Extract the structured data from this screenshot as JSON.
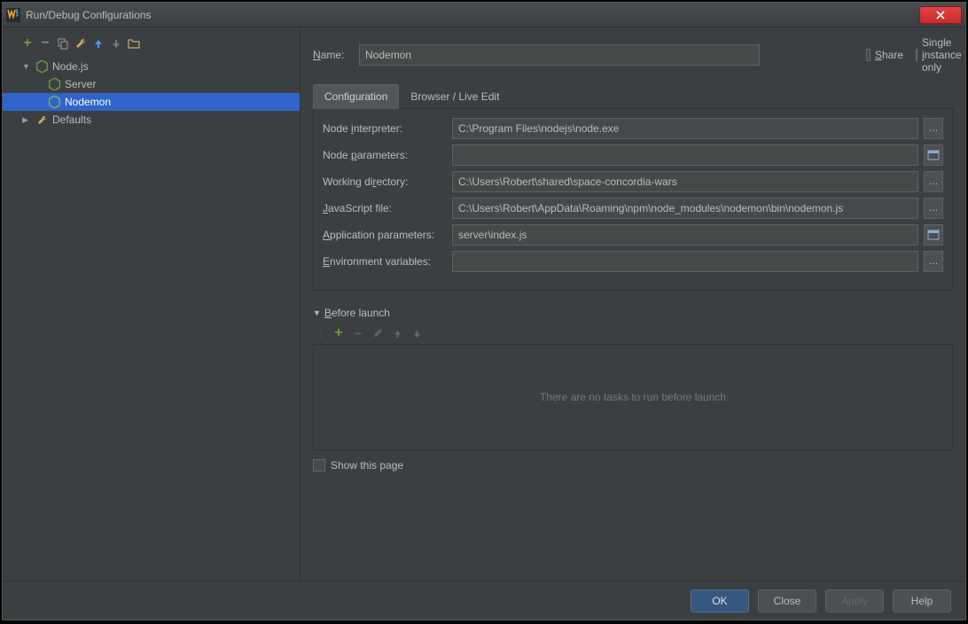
{
  "window": {
    "title": "Run/Debug Configurations"
  },
  "tree": {
    "nodejs": {
      "label": "Node.js"
    },
    "server": {
      "label": "Server"
    },
    "nodemon": {
      "label": "Nodemon"
    },
    "defaults": {
      "label": "Defaults"
    }
  },
  "name_field": {
    "label": "Name:",
    "value": "Nodemon"
  },
  "share": {
    "label": "Share"
  },
  "single_instance": {
    "label": "Single instance only"
  },
  "tabs": {
    "configuration": "Configuration",
    "browser": "Browser / Live Edit"
  },
  "form": {
    "node_interpreter": {
      "label": "Node interpreter:",
      "value": "C:\\Program Files\\nodejs\\node.exe"
    },
    "node_parameters": {
      "label": "Node parameters:",
      "value": ""
    },
    "working_directory": {
      "label": "Working directory:",
      "value": "C:\\Users\\Robert\\shared\\space-concordia-wars"
    },
    "javascript_file": {
      "label": "JavaScript file:",
      "value": "C:\\Users\\Robert\\AppData\\Roaming\\npm\\node_modules\\nodemon\\bin\\nodemon.js"
    },
    "application_parameters": {
      "label": "Application parameters:",
      "value": "server\\index.js"
    },
    "environment_variables": {
      "label": "Environment variables:",
      "value": ""
    }
  },
  "before_launch": {
    "title": "Before launch",
    "empty_text": "There are no tasks to run before launch"
  },
  "show_page": {
    "label": "Show this page"
  },
  "buttons": {
    "ok": "OK",
    "close": "Close",
    "apply": "Apply",
    "help": "Help"
  }
}
